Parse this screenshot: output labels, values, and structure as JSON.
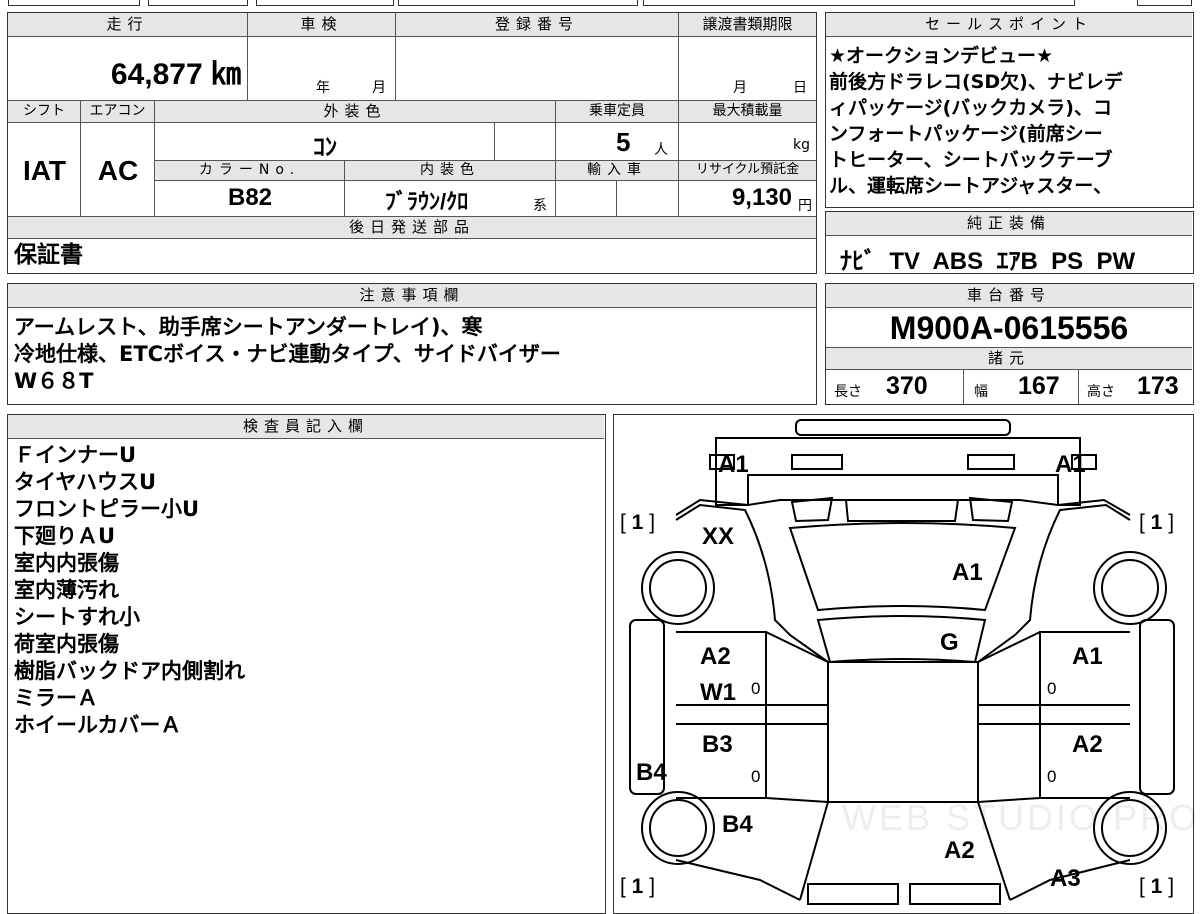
{
  "top_strip": {},
  "vehicle": {
    "mileage_label": "走行",
    "mileage": "64,877 ㎞",
    "inspection_label": "車検",
    "inspection_year_unit": "年",
    "inspection_month_unit": "月",
    "registration_label": "登録番号",
    "deadline_label": "譲渡書類期限",
    "deadline_month_unit": "月",
    "deadline_day_unit": "日",
    "shift_label": "シフト",
    "shift": "IAT",
    "ac_label": "エアコン",
    "ac": "AC",
    "exterior_color_label": "外装色",
    "exterior_color": "ｺﾝ",
    "capacity_label": "乗車定員",
    "capacity": "5",
    "capacity_unit": "人",
    "max_load_label": "最大積載量",
    "max_load_unit": "kg",
    "color_no_label": "カラーNo.",
    "color_no": "B82",
    "interior_color_label": "内装色",
    "interior_color": "ﾌﾞﾗｳﾝ/ｸﾛ",
    "interior_color_suffix": "系",
    "import_label": "輸入車",
    "recycle_label": "リサイクル預託金",
    "recycle_fee": "9,130",
    "recycle_unit": "円"
  },
  "later_parts": {
    "label": "後日発送部品",
    "value": "保証書"
  },
  "notes": {
    "label": "注意事項欄",
    "lines": [
      "アームレスト、助手席シートアンダートレイ)、寒",
      "冷地仕様、ETCボイス・ナビ連動タイプ、サイドバイザー",
      "W６８T"
    ]
  },
  "sales_points": {
    "label": "セールスポイント",
    "lines": [
      "★オークションデビュー★",
      "前後方ドラレコ(SD欠)、ナビレデ",
      "ィパッケージ(バックカメラ)、コ",
      "ンフォートパッケージ(前席シー",
      "トヒーター、シートバックテーブ",
      "ル、運転席シートアジャスター、"
    ]
  },
  "equipment": {
    "label": "純正装備",
    "value": "ﾅﾋﾞ  TV  ABS  ｴｱB  PS  PW"
  },
  "chassis": {
    "label": "車台番号",
    "value": "M900A-0615556"
  },
  "specs": {
    "label": "諸元",
    "length_label": "長さ",
    "length": "370",
    "width_label": "幅",
    "width": "167",
    "height_label": "高さ",
    "height": "173"
  },
  "inspector": {
    "label": "検査員記入欄",
    "lines": [
      "ＦインナーU",
      "タイヤハウスU",
      "フロントピラー小U",
      "下廻りＡU",
      "室内内張傷",
      "室内薄汚れ",
      "シートすれ小",
      "荷室内張傷",
      "樹脂バックドア内側割れ",
      "ミラーＡ",
      "ホイールカバーＡ"
    ]
  },
  "diagram": {
    "watermark": "WEB STUDIO PRO",
    "bracket_value": "1",
    "tire_depth": "0",
    "marks": {
      "front_left": "A1",
      "front_right": "A1",
      "front_panel": "XX",
      "hood": "A1",
      "windshield": "G",
      "left_front_door": "A2",
      "left_front_door_2": "W1",
      "right_front_door": "A1",
      "left_rear_door": "B3",
      "right_rear_door": "A2",
      "left_side": "B4",
      "left_rear": "B4",
      "rear_center": "A2",
      "rear_right": "A3"
    }
  }
}
